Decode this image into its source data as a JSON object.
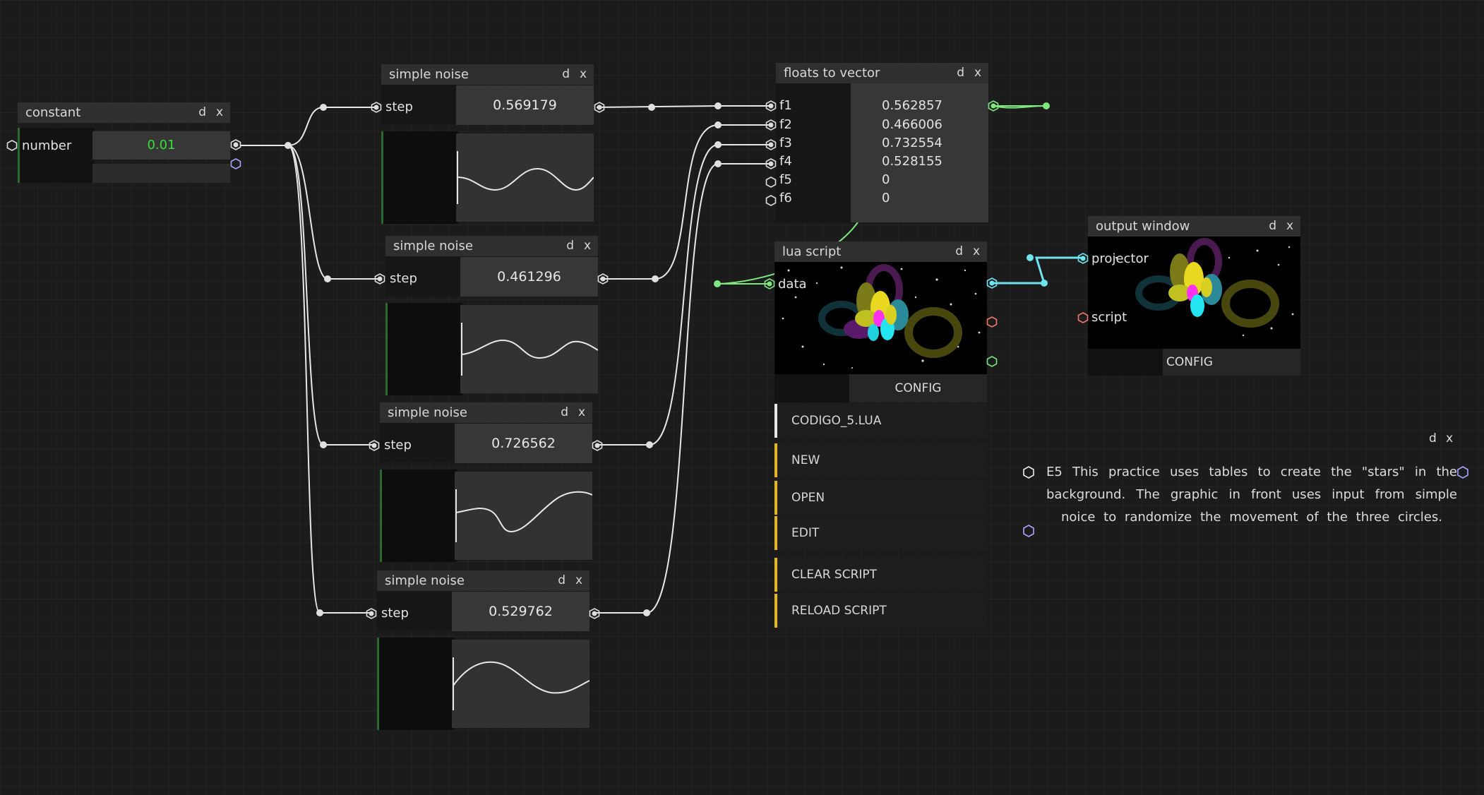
{
  "colors": {
    "wire_white": "#e8e8e8",
    "wire_green": "#7de87d",
    "wire_cyan": "#6fe3ef",
    "accent_yellow": "#e7b718",
    "constant_value_green": "#38e038"
  },
  "constant": {
    "title": "constant",
    "d": "d",
    "x": "x",
    "label": "number",
    "value": "0.01"
  },
  "noise_nodes": [
    {
      "title": "simple noise",
      "d": "d",
      "x": "x",
      "label": "step",
      "value": "0.569179"
    },
    {
      "title": "simple noise",
      "d": "d",
      "x": "x",
      "label": "step",
      "value": "0.461296"
    },
    {
      "title": "simple noise",
      "d": "d",
      "x": "x",
      "label": "step",
      "value": "0.726562"
    },
    {
      "title": "simple noise",
      "d": "d",
      "x": "x",
      "label": "step",
      "value": "0.529762"
    }
  ],
  "floats": {
    "title": "floats to vector",
    "d": "d",
    "x": "x",
    "rows": [
      {
        "label": "f1",
        "value": "0.562857"
      },
      {
        "label": "f2",
        "value": "0.466006"
      },
      {
        "label": "f3",
        "value": "0.732554"
      },
      {
        "label": "f4",
        "value": "0.528155"
      },
      {
        "label": "f5",
        "value": "0"
      },
      {
        "label": "f6",
        "value": "0"
      }
    ]
  },
  "lua": {
    "title": "lua script",
    "d": "d",
    "x": "x",
    "input": "data",
    "config": "CONFIG",
    "file": "CODIGO_5.LUA",
    "buttons": [
      "NEW",
      "OPEN",
      "EDIT",
      "CLEAR SCRIPT",
      "RELOAD SCRIPT"
    ]
  },
  "output": {
    "title": "output window",
    "d": "d",
    "x": "x",
    "input1": "projector",
    "input2": "script",
    "config": "CONFIG"
  },
  "comment": {
    "d": "d",
    "x": "x",
    "text": "E5 This practice uses tables to create the \"stars\" in the background. The graphic in front uses input from simple noice to randomize the movement of the three circles."
  },
  "icons": [
    "hexagon-port-icon",
    "close-icon"
  ]
}
